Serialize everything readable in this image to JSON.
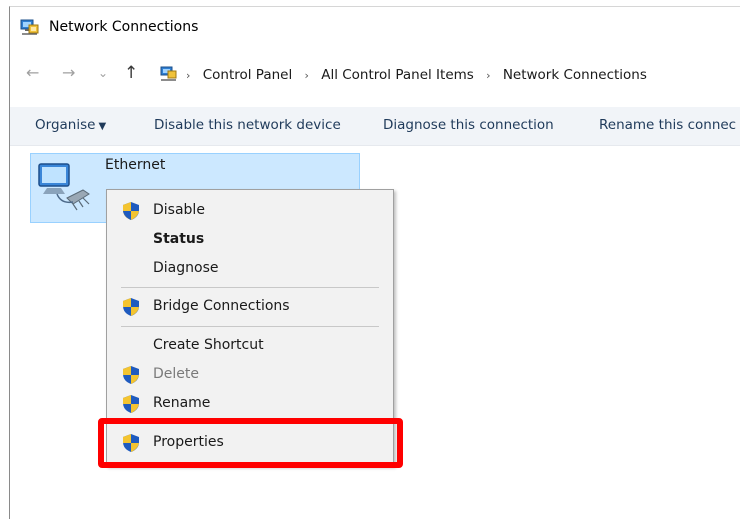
{
  "window": {
    "title": "Network Connections"
  },
  "nav": {
    "back": "←",
    "forward": "→",
    "recent": "⌄",
    "up": "↑"
  },
  "breadcrumb": {
    "separator": "›",
    "items": [
      "Control Panel",
      "All Control Panel Items",
      "Network Connections"
    ]
  },
  "toolbar": {
    "organise": "Organise",
    "disable_device": "Disable this network device",
    "diagnose": "Diagnose this connection",
    "rename": "Rename this connec"
  },
  "item": {
    "name": "Ethernet"
  },
  "context_menu": {
    "items": [
      {
        "label": "Disable",
        "shield": true
      },
      {
        "label": "Status",
        "bold": true
      },
      {
        "label": "Diagnose"
      },
      {
        "label": "Bridge Connections",
        "shield": true
      },
      {
        "label": "Create Shortcut"
      },
      {
        "label": "Delete",
        "shield": true,
        "disabled": true
      },
      {
        "label": "Rename",
        "shield": true
      },
      {
        "label": "Properties",
        "shield": true
      }
    ]
  },
  "colors": {
    "selection": "#cce8ff",
    "highlight": "#ff0000",
    "toolbar_bg": "#f1f4f8"
  }
}
